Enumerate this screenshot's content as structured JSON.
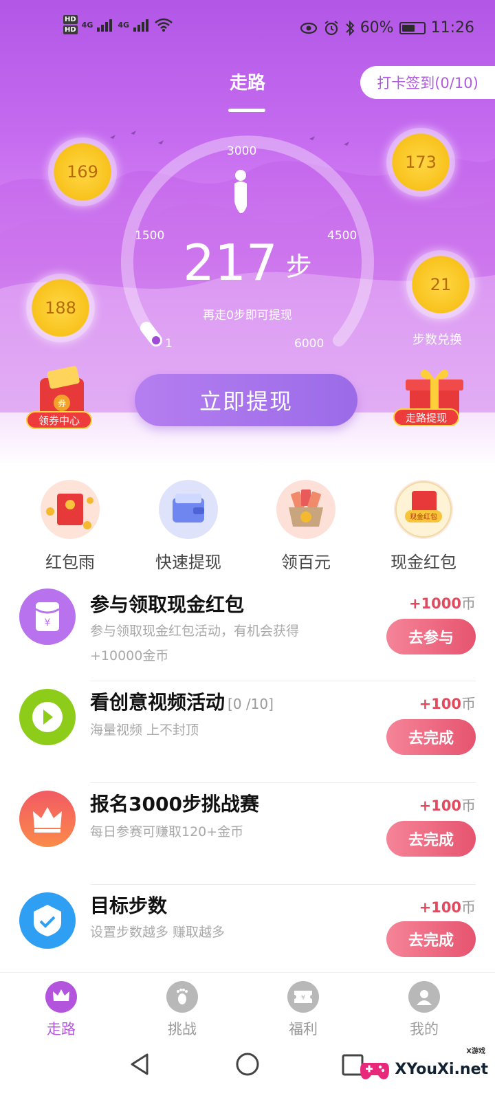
{
  "status": {
    "sim1": "HD",
    "sim2": "HD",
    "network": "4G",
    "battery": "60%",
    "battery_level": 0.6,
    "time": "11:26"
  },
  "header": {
    "tab": "走路",
    "checkin": "打卡签到(0/10)"
  },
  "gauge": {
    "max_top": "3000",
    "left": "1500",
    "right": "4500",
    "start": "1",
    "end": "6000",
    "steps": "217",
    "unit": "步",
    "hint": "再走0步即可提现"
  },
  "coins": [
    {
      "value": "169"
    },
    {
      "value": "173"
    },
    {
      "value": "188"
    },
    {
      "value": "21",
      "caption": "步数兑换"
    }
  ],
  "badges": {
    "left": "领券中心",
    "right": "走路提现"
  },
  "withdraw_button": "立即提现",
  "quick": [
    {
      "label": "红包雨",
      "icon": "red-envelope-icon"
    },
    {
      "label": "快速提现",
      "icon": "wallet-icon"
    },
    {
      "label": "领百元",
      "icon": "money-bag-icon"
    },
    {
      "label": "现金红包",
      "icon": "cash-envelope-icon",
      "badge": "现金红包"
    }
  ],
  "tasks": [
    {
      "title": "参与领取现金红包",
      "count": "",
      "desc": "参与领取现金红包活动，有机会获得+10000金币",
      "reward": "+1000",
      "unit": "币",
      "button": "去参与",
      "icon": "envelope-icon",
      "color": "#b972ee"
    },
    {
      "title": "看创意视频活动",
      "count": "[0 /10]",
      "desc": "海量视频 上不封顶",
      "reward": "+100",
      "unit": "币",
      "button": "去完成",
      "icon": "play-icon",
      "color": "#8dcc18"
    },
    {
      "title": "报名3000步挑战赛",
      "count": "",
      "desc": "每日参赛可赚取120+金币",
      "reward": "+100",
      "unit": "币",
      "button": "去完成",
      "icon": "crown-icon",
      "color": "#f25a64"
    },
    {
      "title": "目标步数",
      "count": "",
      "desc": "设置步数越多 赚取越多",
      "reward": "+100",
      "unit": "币",
      "button": "去完成",
      "icon": "check-shield-icon",
      "color": "#2f9ff3"
    }
  ],
  "nav": [
    {
      "label": "走路",
      "icon": "crown-icon"
    },
    {
      "label": "挑战",
      "icon": "footprint-icon"
    },
    {
      "label": "福利",
      "icon": "ticket-icon"
    },
    {
      "label": "我的",
      "icon": "user-icon"
    }
  ],
  "watermark": {
    "main": "XYouXi.net",
    "small": "X游戏"
  },
  "colors": {
    "primary": "#b355dc",
    "accent": "#e6546f"
  }
}
